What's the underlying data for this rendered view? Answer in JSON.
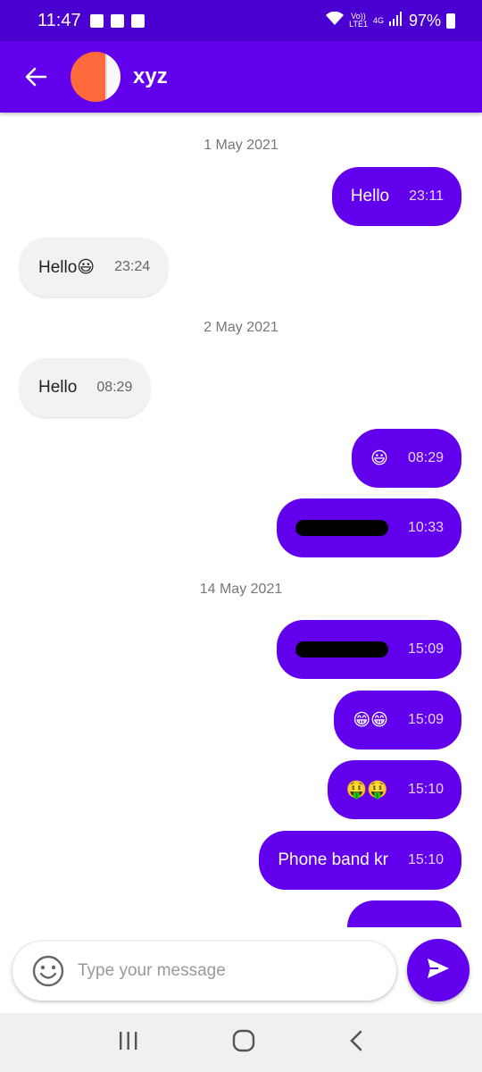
{
  "status_bar": {
    "time": "11:47",
    "network_top": "Vo))",
    "network_bottom": "LTE1",
    "network_type": "4G",
    "battery": "97%"
  },
  "header": {
    "contact_name": "xyz",
    "back_icon": "arrow-left-icon"
  },
  "messages": [
    {
      "date": "1 May 2021"
    },
    {
      "text": "Hello",
      "time": "23:11",
      "dir": "out"
    },
    {
      "text": "Hello😃",
      "time": "23:24",
      "dir": "in"
    },
    {
      "date": "2 May 2021"
    },
    {
      "text": "Hello",
      "time": "08:29",
      "dir": "in"
    },
    {
      "text": "😃",
      "time": "08:29",
      "dir": "out"
    },
    {
      "text": "",
      "time": "10:33",
      "dir": "out",
      "redacted": true
    },
    {
      "date": "14 May 2021"
    },
    {
      "text": "",
      "time": "15:09",
      "dir": "out",
      "redacted": true
    },
    {
      "text": "😁😁",
      "time": "15:09",
      "dir": "out"
    },
    {
      "text": "🤑🤑",
      "time": "15:10",
      "dir": "out"
    },
    {
      "text": "Phone band kr",
      "time": "15:10",
      "dir": "out"
    }
  ],
  "composer": {
    "placeholder": "Type your message",
    "emoji_icon": "smiley-icon",
    "send_icon": "send-icon"
  },
  "colors": {
    "primary": "#6200ee",
    "status_bar": "#4a00d0",
    "incoming_bubble": "#f2f2f2"
  }
}
